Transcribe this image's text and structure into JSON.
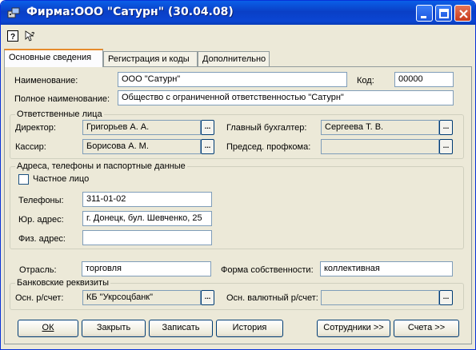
{
  "window": {
    "title": "Фирма:ООО \"Сатурн\" (30.04.08)"
  },
  "toolbar": {
    "help_icon": "help-icon",
    "whatsthis_icon": "context-help-icon"
  },
  "tabs": [
    {
      "label": "Основные сведения"
    },
    {
      "label": "Регистрация и коды"
    },
    {
      "label": "Дополнительно"
    }
  ],
  "form": {
    "name_label": "Наименование:",
    "name_value": "ООО \"Сатурн\"",
    "code_label": "Код:",
    "code_value": "00000",
    "fullname_label": "Полное наименование:",
    "fullname_value": "Общество с ограниченной ответственностью \"Сатурн\""
  },
  "responsible": {
    "title": "Ответственные лица",
    "director_label": "Директор:",
    "director_value": "Григорьев А. А.",
    "chief_accountant_label": "Главный бухгалтер:",
    "chief_accountant_value": "Сергеева Т. В.",
    "cashier_label": "Кассир:",
    "cashier_value": "Борисова А. М.",
    "union_label": "Председ. профкома:",
    "union_value": "",
    "dots_label": "..."
  },
  "addresses": {
    "title": "Адреса, телефоны и паспортные данные",
    "private_person_label": "Частное лицо",
    "private_person_checked": false,
    "phones_label": "Телефоны:",
    "phones_value": "311-01-02",
    "legal_address_label": "Юр. адрес:",
    "legal_address_value": "г. Донецк, бул. Шевченко, 25",
    "physical_address_label": "Физ. адрес:",
    "physical_address_value": ""
  },
  "business": {
    "industry_label": "Отрасль:",
    "industry_value": "торговля",
    "ownership_label": "Форма собственности:",
    "ownership_value": "коллективная"
  },
  "bank": {
    "title": "Банковские реквизиты",
    "main_account_label": "Осн. р/счет:",
    "main_account_value": "КБ \"Укрсоцбанк\"",
    "currency_account_label": "Осн. валютный р/счет:",
    "currency_account_value": ""
  },
  "buttons": {
    "ok": "ОК",
    "close": "Закрыть",
    "save": "Записать",
    "history": "История",
    "employees": "Сотрудники >>",
    "accounts": "Счета >>"
  }
}
